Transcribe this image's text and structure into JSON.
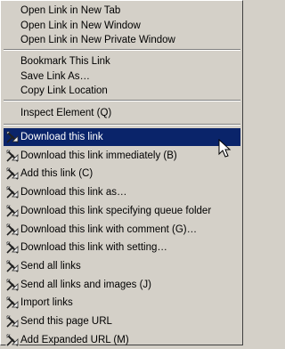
{
  "menu": {
    "group1": [
      {
        "label": "Open Link in New Tab"
      },
      {
        "label": "Open Link in New Window"
      },
      {
        "label": "Open Link in New Private Window"
      }
    ],
    "group2": [
      {
        "label": "Bookmark This Link"
      },
      {
        "label": "Save Link As…"
      },
      {
        "label": "Copy Link Location"
      }
    ],
    "group3": [
      {
        "label": "Inspect Element (Q)"
      }
    ],
    "group4": [
      {
        "label": "Download this link",
        "highlighted": true
      },
      {
        "label": "Download this link immediately (B)"
      },
      {
        "label": "Add this link (C)"
      },
      {
        "label": "Download this link as…"
      },
      {
        "label": "Download this link specifying queue folder"
      },
      {
        "label": "Download this link with comment (G)…"
      },
      {
        "label": "Download this link with setting…"
      },
      {
        "label": "Send all links"
      },
      {
        "label": "Send all links and images (J)"
      },
      {
        "label": "Import links"
      },
      {
        "label": "Send this page URL"
      },
      {
        "label": "Add Expanded URL (M)"
      }
    ]
  },
  "icons": {
    "download_item": "downloader-arrow-icon",
    "cursor": "mouse-pointer-icon"
  },
  "colors": {
    "menu_bg": "#d4d0c8",
    "highlight_bg": "#0a246a",
    "highlight_text": "#ffffff"
  }
}
